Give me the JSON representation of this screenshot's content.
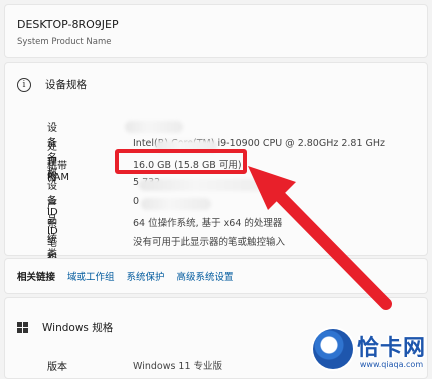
{
  "device": {
    "name": "DESKTOP-8RO9JEP",
    "subtitle": "System Product Name"
  },
  "specs": {
    "title": "设备规格",
    "rows": [
      {
        "label": "设备名称",
        "value": ""
      },
      {
        "label": "处理器",
        "value": "Intel(R) Core(TM) i9-10900 CPU @ 2.80GHz   2.81 GHz"
      },
      {
        "label": "机带 RAM",
        "value": "16.0 GB (15.8 GB 可用)"
      },
      {
        "label": "设备 ID",
        "value": "5                                           732"
      },
      {
        "label": "产品 ID",
        "value": "0"
      },
      {
        "label": "系统类型",
        "value": "64 位操作系统, 基于 x64 的处理器"
      },
      {
        "label": "笔和触控",
        "value": "没有可用于此显示器的笔或触控输入"
      }
    ]
  },
  "links": {
    "lead": "相关链接",
    "items": [
      "域或工作组",
      "系统保护",
      "高级系统设置"
    ]
  },
  "windows": {
    "title": "Windows 规格",
    "rows": [
      {
        "label": "版本",
        "value": "Windows 11 专业版"
      }
    ]
  },
  "annotation": {
    "color": "#e8202a"
  },
  "watermark": {
    "text": "恰卡网",
    "url": "www.qiaqa.com",
    "color": "#1e56ad"
  }
}
